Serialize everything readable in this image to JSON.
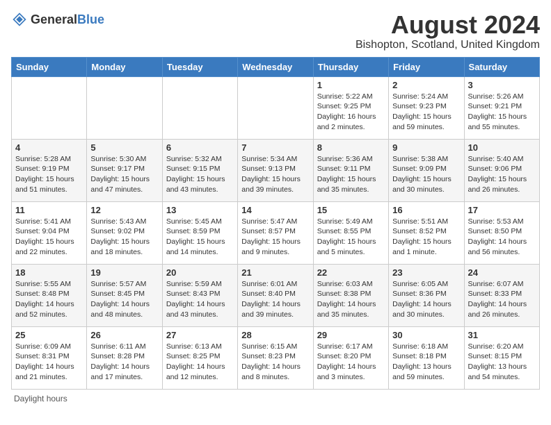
{
  "header": {
    "logo_general": "General",
    "logo_blue": "Blue",
    "month_year": "August 2024",
    "location": "Bishopton, Scotland, United Kingdom"
  },
  "weekdays": [
    "Sunday",
    "Monday",
    "Tuesday",
    "Wednesday",
    "Thursday",
    "Friday",
    "Saturday"
  ],
  "footer": {
    "daylight_label": "Daylight hours"
  },
  "weeks": [
    [
      {
        "day": "",
        "sunrise": "",
        "sunset": "",
        "daylight": ""
      },
      {
        "day": "",
        "sunrise": "",
        "sunset": "",
        "daylight": ""
      },
      {
        "day": "",
        "sunrise": "",
        "sunset": "",
        "daylight": ""
      },
      {
        "day": "",
        "sunrise": "",
        "sunset": "",
        "daylight": ""
      },
      {
        "day": "1",
        "sunrise": "Sunrise: 5:22 AM",
        "sunset": "Sunset: 9:25 PM",
        "daylight": "Daylight: 16 hours and 2 minutes."
      },
      {
        "day": "2",
        "sunrise": "Sunrise: 5:24 AM",
        "sunset": "Sunset: 9:23 PM",
        "daylight": "Daylight: 15 hours and 59 minutes."
      },
      {
        "day": "3",
        "sunrise": "Sunrise: 5:26 AM",
        "sunset": "Sunset: 9:21 PM",
        "daylight": "Daylight: 15 hours and 55 minutes."
      }
    ],
    [
      {
        "day": "4",
        "sunrise": "Sunrise: 5:28 AM",
        "sunset": "Sunset: 9:19 PM",
        "daylight": "Daylight: 15 hours and 51 minutes."
      },
      {
        "day": "5",
        "sunrise": "Sunrise: 5:30 AM",
        "sunset": "Sunset: 9:17 PM",
        "daylight": "Daylight: 15 hours and 47 minutes."
      },
      {
        "day": "6",
        "sunrise": "Sunrise: 5:32 AM",
        "sunset": "Sunset: 9:15 PM",
        "daylight": "Daylight: 15 hours and 43 minutes."
      },
      {
        "day": "7",
        "sunrise": "Sunrise: 5:34 AM",
        "sunset": "Sunset: 9:13 PM",
        "daylight": "Daylight: 15 hours and 39 minutes."
      },
      {
        "day": "8",
        "sunrise": "Sunrise: 5:36 AM",
        "sunset": "Sunset: 9:11 PM",
        "daylight": "Daylight: 15 hours and 35 minutes."
      },
      {
        "day": "9",
        "sunrise": "Sunrise: 5:38 AM",
        "sunset": "Sunset: 9:09 PM",
        "daylight": "Daylight: 15 hours and 30 minutes."
      },
      {
        "day": "10",
        "sunrise": "Sunrise: 5:40 AM",
        "sunset": "Sunset: 9:06 PM",
        "daylight": "Daylight: 15 hours and 26 minutes."
      }
    ],
    [
      {
        "day": "11",
        "sunrise": "Sunrise: 5:41 AM",
        "sunset": "Sunset: 9:04 PM",
        "daylight": "Daylight: 15 hours and 22 minutes."
      },
      {
        "day": "12",
        "sunrise": "Sunrise: 5:43 AM",
        "sunset": "Sunset: 9:02 PM",
        "daylight": "Daylight: 15 hours and 18 minutes."
      },
      {
        "day": "13",
        "sunrise": "Sunrise: 5:45 AM",
        "sunset": "Sunset: 8:59 PM",
        "daylight": "Daylight: 15 hours and 14 minutes."
      },
      {
        "day": "14",
        "sunrise": "Sunrise: 5:47 AM",
        "sunset": "Sunset: 8:57 PM",
        "daylight": "Daylight: 15 hours and 9 minutes."
      },
      {
        "day": "15",
        "sunrise": "Sunrise: 5:49 AM",
        "sunset": "Sunset: 8:55 PM",
        "daylight": "Daylight: 15 hours and 5 minutes."
      },
      {
        "day": "16",
        "sunrise": "Sunrise: 5:51 AM",
        "sunset": "Sunset: 8:52 PM",
        "daylight": "Daylight: 15 hours and 1 minute."
      },
      {
        "day": "17",
        "sunrise": "Sunrise: 5:53 AM",
        "sunset": "Sunset: 8:50 PM",
        "daylight": "Daylight: 14 hours and 56 minutes."
      }
    ],
    [
      {
        "day": "18",
        "sunrise": "Sunrise: 5:55 AM",
        "sunset": "Sunset: 8:48 PM",
        "daylight": "Daylight: 14 hours and 52 minutes."
      },
      {
        "day": "19",
        "sunrise": "Sunrise: 5:57 AM",
        "sunset": "Sunset: 8:45 PM",
        "daylight": "Daylight: 14 hours and 48 minutes."
      },
      {
        "day": "20",
        "sunrise": "Sunrise: 5:59 AM",
        "sunset": "Sunset: 8:43 PM",
        "daylight": "Daylight: 14 hours and 43 minutes."
      },
      {
        "day": "21",
        "sunrise": "Sunrise: 6:01 AM",
        "sunset": "Sunset: 8:40 PM",
        "daylight": "Daylight: 14 hours and 39 minutes."
      },
      {
        "day": "22",
        "sunrise": "Sunrise: 6:03 AM",
        "sunset": "Sunset: 8:38 PM",
        "daylight": "Daylight: 14 hours and 35 minutes."
      },
      {
        "day": "23",
        "sunrise": "Sunrise: 6:05 AM",
        "sunset": "Sunset: 8:36 PM",
        "daylight": "Daylight: 14 hours and 30 minutes."
      },
      {
        "day": "24",
        "sunrise": "Sunrise: 6:07 AM",
        "sunset": "Sunset: 8:33 PM",
        "daylight": "Daylight: 14 hours and 26 minutes."
      }
    ],
    [
      {
        "day": "25",
        "sunrise": "Sunrise: 6:09 AM",
        "sunset": "Sunset: 8:31 PM",
        "daylight": "Daylight: 14 hours and 21 minutes."
      },
      {
        "day": "26",
        "sunrise": "Sunrise: 6:11 AM",
        "sunset": "Sunset: 8:28 PM",
        "daylight": "Daylight: 14 hours and 17 minutes."
      },
      {
        "day": "27",
        "sunrise": "Sunrise: 6:13 AM",
        "sunset": "Sunset: 8:25 PM",
        "daylight": "Daylight: 14 hours and 12 minutes."
      },
      {
        "day": "28",
        "sunrise": "Sunrise: 6:15 AM",
        "sunset": "Sunset: 8:23 PM",
        "daylight": "Daylight: 14 hours and 8 minutes."
      },
      {
        "day": "29",
        "sunrise": "Sunrise: 6:17 AM",
        "sunset": "Sunset: 8:20 PM",
        "daylight": "Daylight: 14 hours and 3 minutes."
      },
      {
        "day": "30",
        "sunrise": "Sunrise: 6:18 AM",
        "sunset": "Sunset: 8:18 PM",
        "daylight": "Daylight: 13 hours and 59 minutes."
      },
      {
        "day": "31",
        "sunrise": "Sunrise: 6:20 AM",
        "sunset": "Sunset: 8:15 PM",
        "daylight": "Daylight: 13 hours and 54 minutes."
      }
    ]
  ]
}
